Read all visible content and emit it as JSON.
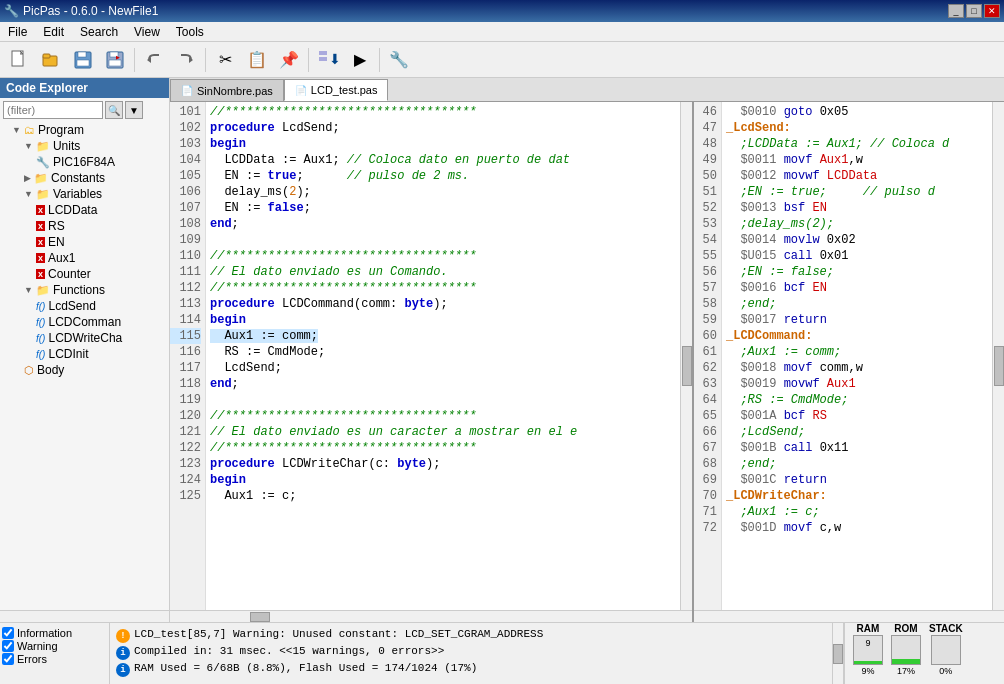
{
  "titlebar": {
    "title": "PicPas - 0.6.0 - NewFile1",
    "icon": "🔧",
    "controls": [
      "_",
      "□",
      "✕"
    ]
  },
  "menubar": {
    "items": [
      "File",
      "Edit",
      "Search",
      "View",
      "Tools"
    ]
  },
  "toolbar": {
    "buttons": [
      {
        "name": "new",
        "icon": "📄"
      },
      {
        "name": "open",
        "icon": "📂"
      },
      {
        "name": "save",
        "icon": "💾"
      },
      {
        "name": "save-img",
        "icon": "🖼"
      },
      {
        "name": "undo",
        "icon": "↩"
      },
      {
        "name": "redo",
        "icon": "↪"
      },
      {
        "name": "cut",
        "icon": "✂"
      },
      {
        "name": "copy",
        "icon": "📋"
      },
      {
        "name": "paste",
        "icon": "📌"
      },
      {
        "name": "compile",
        "icon": "⬇"
      },
      {
        "name": "run",
        "icon": "▶"
      },
      {
        "name": "settings",
        "icon": "🔧"
      }
    ]
  },
  "sidebar": {
    "title": "Code Explorer",
    "filter_placeholder": "(filter)",
    "tree": [
      {
        "level": 1,
        "type": "expand",
        "label": "Program"
      },
      {
        "level": 2,
        "type": "expand",
        "label": "Units"
      },
      {
        "level": 3,
        "type": "item",
        "label": "PIC16F84A"
      },
      {
        "level": 2,
        "type": "item",
        "label": "Constants"
      },
      {
        "level": 2,
        "type": "expand",
        "label": "Variables"
      },
      {
        "level": 3,
        "type": "var",
        "label": "LCDData"
      },
      {
        "level": 3,
        "type": "var",
        "label": "RS"
      },
      {
        "level": 3,
        "type": "var",
        "label": "EN"
      },
      {
        "level": 3,
        "type": "var",
        "label": "Aux1"
      },
      {
        "level": 3,
        "type": "var",
        "label": "Counter"
      },
      {
        "level": 2,
        "type": "expand",
        "label": "Functions"
      },
      {
        "level": 3,
        "type": "func",
        "label": "LcdSend"
      },
      {
        "level": 3,
        "type": "func",
        "label": "LCDComman"
      },
      {
        "level": 3,
        "type": "func",
        "label": "LCDWriteCha"
      },
      {
        "level": 3,
        "type": "func",
        "label": "LCDInit"
      },
      {
        "level": 2,
        "type": "body",
        "label": "Body"
      }
    ]
  },
  "tabs": [
    {
      "label": "SinNombre.pas",
      "active": false
    },
    {
      "label": "LCD_test.pas",
      "active": true
    }
  ],
  "code_lines": [
    {
      "num": 101,
      "text": "//***********************************"
    },
    {
      "num": 102,
      "text": "procedure LcdSend;"
    },
    {
      "num": 103,
      "text": "begin"
    },
    {
      "num": 104,
      "text": "  LCDData := Aux1; // Coloca dato en puerto de dat"
    },
    {
      "num": 105,
      "text": "  EN := true;      // pulso de 2 ms."
    },
    {
      "num": 106,
      "text": "  delay_ms(2);"
    },
    {
      "num": 107,
      "text": "  EN := false;"
    },
    {
      "num": 108,
      "text": "end;"
    },
    {
      "num": 109,
      "text": ""
    },
    {
      "num": 110,
      "text": "//***********************************"
    },
    {
      "num": 111,
      "text": "// El dato enviado es un Comando."
    },
    {
      "num": 112,
      "text": "//***********************************"
    },
    {
      "num": 113,
      "text": "procedure LCDCommand(comm: byte);"
    },
    {
      "num": 114,
      "text": "begin"
    },
    {
      "num": 115,
      "text": "  Aux1 := comm;"
    },
    {
      "num": 116,
      "text": "  RS := CmdMode;"
    },
    {
      "num": 117,
      "text": "  LcdSend;"
    },
    {
      "num": 118,
      "text": "end;"
    },
    {
      "num": 119,
      "text": ""
    },
    {
      "num": 120,
      "text": "//***********************************"
    },
    {
      "num": 121,
      "text": "// El dato enviado es un caracter a mostrar en el e"
    },
    {
      "num": 122,
      "text": "//***********************************"
    },
    {
      "num": 123,
      "text": "procedure LCDWriteChar(c: byte);"
    },
    {
      "num": 124,
      "text": "begin"
    },
    {
      "num": 125,
      "text": "  Aux1 := c;"
    }
  ],
  "asm_lines": [
    {
      "num": 46,
      "text": "  $0010 goto 0x05"
    },
    {
      "num": 47,
      "text": "_LcdSend:"
    },
    {
      "num": 48,
      "text": "  ;LCDData := Aux1; // Coloca d"
    },
    {
      "num": 49,
      "text": "  $0011 movf Aux1,w"
    },
    {
      "num": 50,
      "text": "  $0012 movwf LCDData"
    },
    {
      "num": 51,
      "text": "  ;EN := true;     // pulso d"
    },
    {
      "num": 52,
      "text": "  $0013 bsf EN"
    },
    {
      "num": 53,
      "text": "  ;delay_ms(2);"
    },
    {
      "num": 54,
      "text": "  $0014 movlw 0x02"
    },
    {
      "num": 55,
      "text": "  $U015 call 0x01"
    },
    {
      "num": 56,
      "text": "  ;EN := false;"
    },
    {
      "num": 57,
      "text": "  $0016 bcf EN"
    },
    {
      "num": 58,
      "text": "  ;end;"
    },
    {
      "num": 59,
      "text": "  $0017 return"
    },
    {
      "num": 60,
      "text": "_LCDCommand:"
    },
    {
      "num": 61,
      "text": "  ;Aux1 := comm;"
    },
    {
      "num": 62,
      "text": "  $0018 movf comm,w"
    },
    {
      "num": 63,
      "text": "  $0019 movwf Aux1"
    },
    {
      "num": 64,
      "text": "  ;RS := CmdMode;"
    },
    {
      "num": 65,
      "text": "  $001A bcf RS"
    },
    {
      "num": 66,
      "text": "  ;LcdSend;"
    },
    {
      "num": 67,
      "text": "  $001B call 0x11"
    },
    {
      "num": 68,
      "text": "  ;end;"
    },
    {
      "num": 69,
      "text": "  $001C return"
    },
    {
      "num": 70,
      "text": "_LCDWriteChar:"
    },
    {
      "num": 71,
      "text": "  ;Aux1 := c;"
    },
    {
      "num": 72,
      "text": "  $001D movf c,w"
    }
  ],
  "log": {
    "checkboxes": [
      {
        "id": "cb-info",
        "label": "Information",
        "checked": true
      },
      {
        "id": "cb-warn",
        "label": "Warning",
        "checked": true
      },
      {
        "id": "cb-err",
        "label": "Errors",
        "checked": true
      }
    ],
    "messages": [
      {
        "type": "warn",
        "text": "LCD_test[85,7] Warning: Unused constant: LCD_SET_CGRAM_ADDRESS"
      },
      {
        "type": "info",
        "text": "Compiled in: 31 msec. <<15 warnings, 0 errors>>"
      },
      {
        "type": "info",
        "text": "RAM Used   = 6/68B (8.8%), Flash Used = 174/1024 (17%)"
      }
    ]
  },
  "stats": {
    "labels": [
      "RAM",
      "ROM",
      "STACK"
    ],
    "values": [
      9,
      17,
      0
    ],
    "colors": [
      "#33cc33",
      "#33cc33",
      "#33cc33"
    ]
  }
}
